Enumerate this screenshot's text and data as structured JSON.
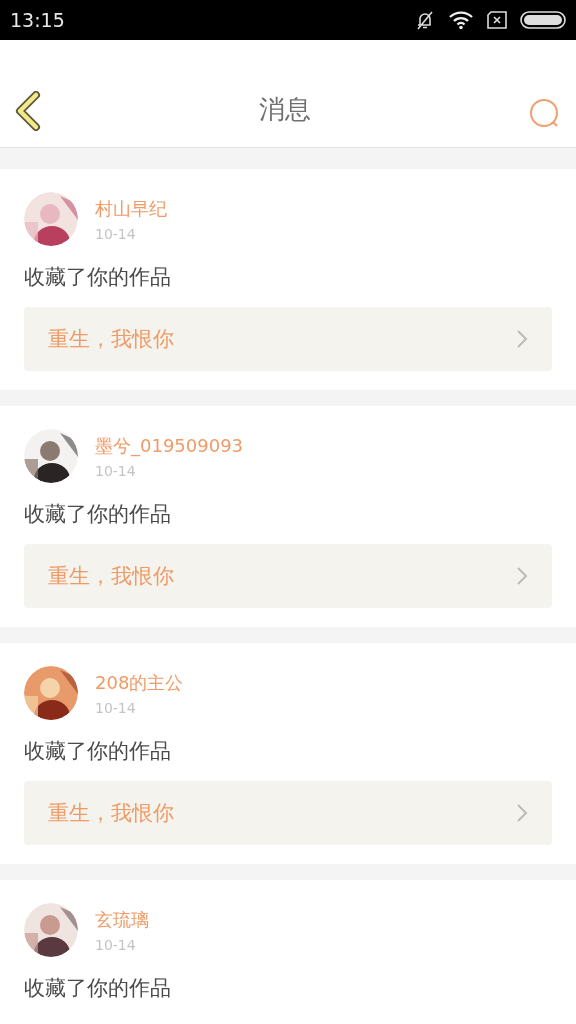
{
  "status_bar": {
    "time": "13:15"
  },
  "header": {
    "title": "消息"
  },
  "messages": [
    {
      "user": "村山早纪",
      "date": "10-14",
      "action": "收藏了你的作品",
      "work": "重生，我恨你"
    },
    {
      "user": "墨兮_019509093",
      "date": "10-14",
      "action": "收藏了你的作品",
      "work": "重生，我恨你"
    },
    {
      "user": "208的主公",
      "date": "10-14",
      "action": "收藏了你的作品",
      "work": "重生，我恨你"
    },
    {
      "user": "玄琉璃",
      "date": "10-14",
      "action": "收藏了你的作品"
    }
  ]
}
